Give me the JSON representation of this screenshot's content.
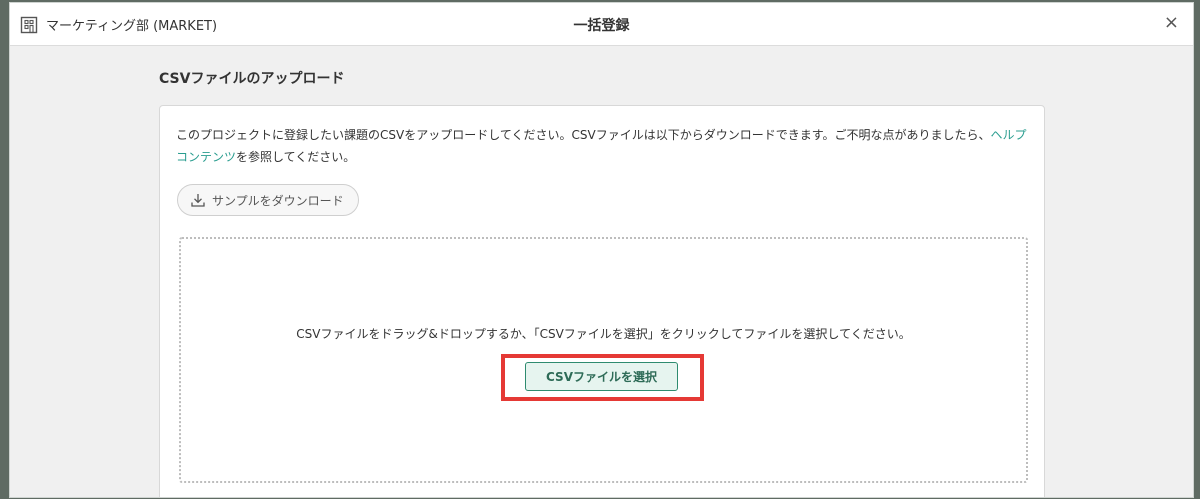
{
  "header": {
    "project_name": "マーケティング部 (MARKET)",
    "title": "一括登録",
    "close_symbol": "×"
  },
  "upload": {
    "section_title": "CSVファイルのアップロード",
    "desc_part1": "このプロジェクトに登録したい課題のCSVをアップロードしてください。CSVファイルは以下からダウンロードできます。ご不明な点がありましたら、",
    "help_link": "ヘルプコンテンツ",
    "desc_part2": "を参照してください。",
    "sample_button": "サンプルをダウンロード",
    "drop_text": "CSVファイルをドラッグ&ドロップするか、「CSVファイルを選択」をクリックしてファイルを選択してください。",
    "select_button": "CSVファイルを選択"
  },
  "colors": {
    "accent": "#2e8b6f",
    "link": "#2a9d8f",
    "highlight": "#e53935"
  },
  "icons": [
    "building-icon",
    "download-icon",
    "close-icon"
  ]
}
